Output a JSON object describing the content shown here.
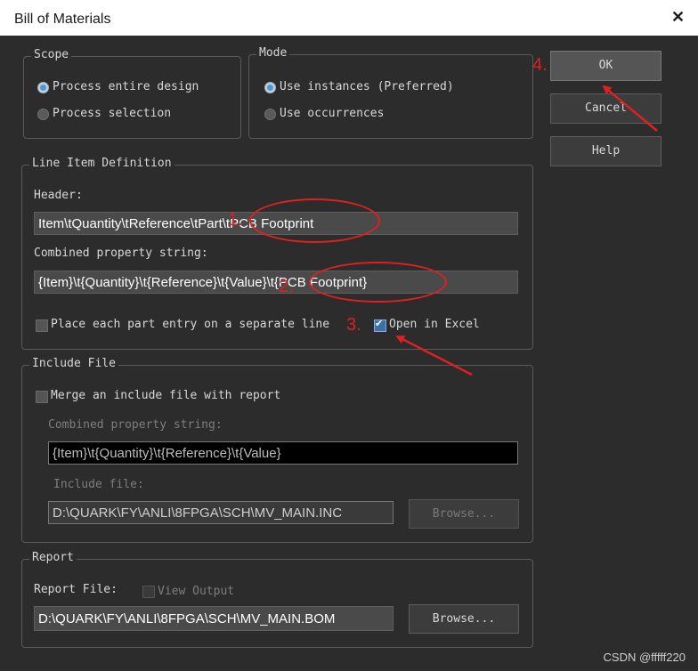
{
  "window": {
    "title": "Bill of Materials",
    "close_glyph": "✕"
  },
  "scope": {
    "label": "Scope",
    "options": [
      {
        "label": "Process entire design",
        "selected": true
      },
      {
        "label": "Process selection",
        "selected": false
      }
    ]
  },
  "mode": {
    "label": "Mode",
    "options": [
      {
        "label": "Use instances (Preferred)",
        "selected": true
      },
      {
        "label": "Use occurrences",
        "selected": false
      }
    ]
  },
  "buttons": {
    "ok": "OK",
    "cancel": "Cancel",
    "help": "Help"
  },
  "line_item": {
    "label": "Line Item Definition",
    "header_label": "Header:",
    "header_value": "Item\\tQuantity\\tReference\\tPart\\tPCB Footprint",
    "combined_label": "Combined property string:",
    "combined_value": "{Item}\\t{Quantity}\\t{Reference}\\t{Value}\\t{PCB Footprint}",
    "separate_line_label": "Place each part entry on a separate line",
    "separate_line_checked": false,
    "open_excel_label": "Open in Excel",
    "open_excel_checked": true
  },
  "include_file": {
    "label": "Include File",
    "merge_label": "Merge an include file with report",
    "merge_checked": false,
    "combined_label": "Combined property string:",
    "combined_value": "{Item}\\t{Quantity}\\t{Reference}\\t{Value}",
    "file_label": "Include file:",
    "file_value": "D:\\QUARK\\FY\\ANLI\\8FPGA\\SCH\\MV_MAIN.INC",
    "browse": "Browse..."
  },
  "report": {
    "label": "Report",
    "file_label": "Report File:",
    "view_output_label": "View Output",
    "view_output_checked": false,
    "file_value": "D:\\QUARK\\FY\\ANLI\\8FPGA\\SCH\\MV_MAIN.BOM",
    "browse": "Browse..."
  },
  "annotations": {
    "one": "1.",
    "two": "2.",
    "three": "3.",
    "four": "4.",
    "color": "#e02020"
  },
  "watermark": "CSDN @fffff220"
}
